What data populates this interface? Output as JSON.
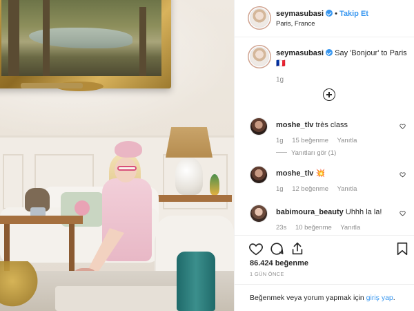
{
  "post": {
    "username": "seymasubasi",
    "follow_label": "Takip Et",
    "separator": "•",
    "location": "Paris, France",
    "caption_text": "Say 'Bonjour' to Paris 🇫🇷",
    "caption_time": "1g"
  },
  "comments": [
    {
      "user": "moshe_tlv",
      "text": "très class",
      "time": "1g",
      "likes": "15 beğenme",
      "reply": "Yanıtla",
      "view_replies": "Yanıtları gör (1)"
    },
    {
      "user": "moshe_tlv",
      "text": "💥",
      "time": "1g",
      "likes": "12 beğenme",
      "reply": "Yanıtla"
    },
    {
      "user": "babimoura_beauty",
      "text": "Uhhh la la!",
      "time": "23s",
      "likes": "10 beğenme",
      "reply": "Yanıtla"
    }
  ],
  "actions": {
    "likes_count": "86.424 beğenme",
    "posted_ago": "1 GÜN ÖNCE",
    "login_prompt": "Beğenmek veya yorum yapmak için",
    "login_link": "giriş yap",
    "login_suffix": "."
  },
  "icons": {
    "like": "heart-icon",
    "comment": "comment-bubble-icon",
    "share": "share-icon",
    "save": "bookmark-icon",
    "more": "plus-circle-icon"
  },
  "colors": {
    "link_blue": "#3897f0",
    "text": "#262626",
    "muted": "#8e8e8e"
  }
}
